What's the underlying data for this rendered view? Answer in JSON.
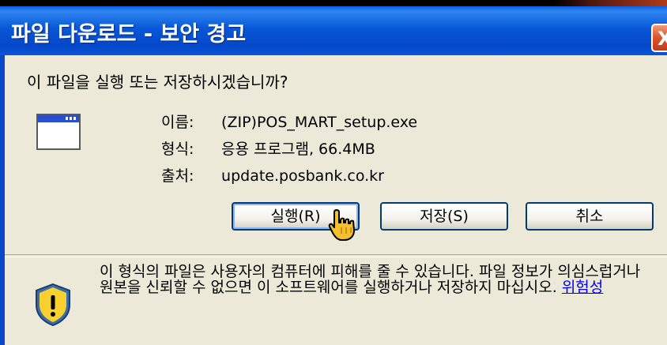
{
  "titlebar": {
    "title": "파일 다운로드 - 보안 경고",
    "close_label": "X"
  },
  "dialog": {
    "question": "이 파일을 실행 또는 저장하시겠습니까?",
    "file_icon": "program-window-icon",
    "info": {
      "name_label": "이름:",
      "name_value": "(ZIP)POS_MART_setup.exe",
      "type_label": "형식:",
      "type_value": "응용 프로그램, 66.4MB",
      "source_label": "출처:",
      "source_value": "update.posbank.co.kr"
    },
    "buttons": {
      "run": "실행(R)",
      "save": "저장(S)",
      "cancel": "취소"
    },
    "warning": {
      "icon": "security-shield-warning-icon",
      "text": "이 형식의 파일은 사용자의 컴퓨터에 피해를 줄 수 있습니다. 파일 정보가 의심스럽거나 원본을 신뢰할 수 없으면 이 소프트웨어를 실행하거나 저장하지 마십시오.",
      "link": "위험성"
    }
  },
  "colors": {
    "titlebar": "#0a55d6",
    "dialog_bg": "#ece9d8",
    "link": "#0000ee"
  }
}
